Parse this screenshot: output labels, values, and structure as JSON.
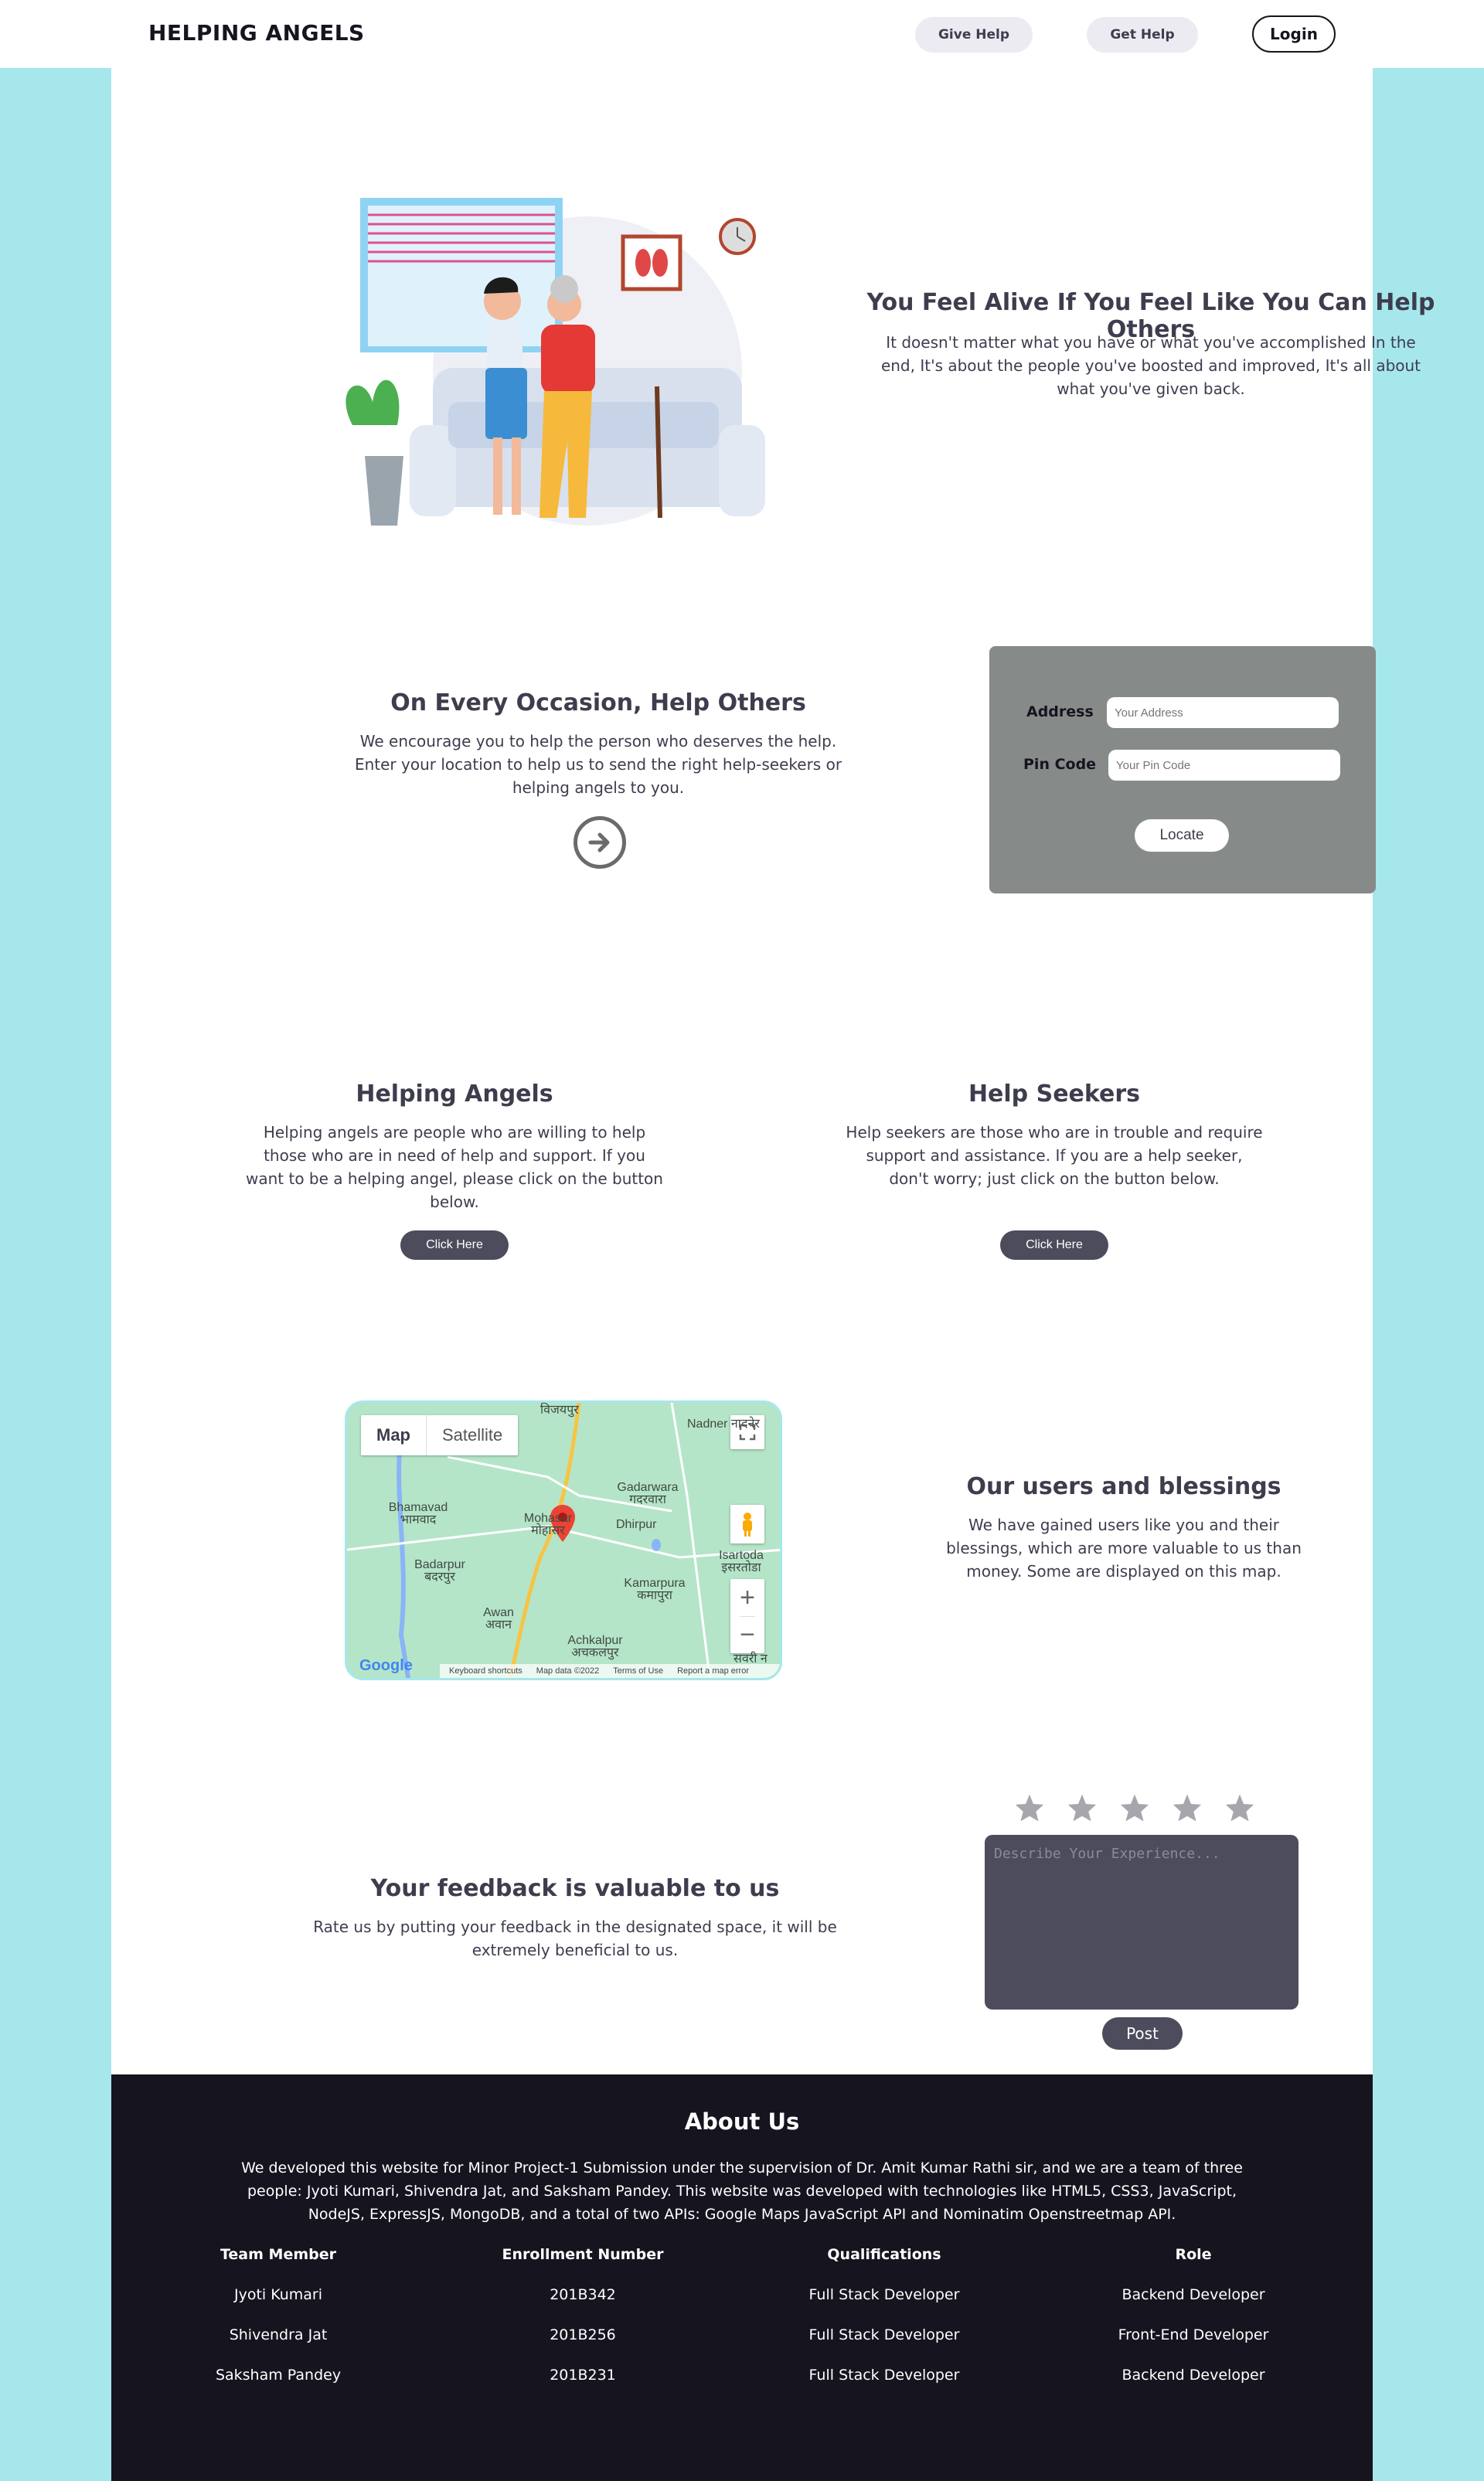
{
  "header": {
    "brand": "HELPING ANGELS",
    "give_help": "Give Help",
    "get_help": "Get Help",
    "login": "Login"
  },
  "hero": {
    "title": "You Feel Alive If You Feel Like You Can Help Others",
    "text": "It doesn't matter what you have or what you've accomplished In the end, It's about the people you've boosted and improved, It's all about what you've given back."
  },
  "occasion": {
    "title": "On Every Occasion, Help Others",
    "text": "We encourage you to help the person who deserves the help. Enter your location to help us to send the right help-seekers or helping angels to you.",
    "address_label": "Address",
    "address_placeholder": "Your Address",
    "pincode_label": "Pin Code",
    "pincode_placeholder": "Your Pin Code",
    "locate_button": "Locate"
  },
  "roles": [
    {
      "title": "Helping Angels",
      "text": "Helping angels are people who are willing to help those who are in need of help and support. If you want to be a helping angel, please click on the button below.",
      "button": "Click Here"
    },
    {
      "title": "Help Seekers",
      "text": "Help seekers are those who are in trouble and require support and assistance. If you are a help seeker, don't worry; just click on the button below.",
      "button": "Click Here"
    }
  ],
  "map": {
    "tab_map": "Map",
    "tab_satellite": "Satellite",
    "places": [
      "विजयपुर",
      "Nadner नादनेर",
      "Gadarwara गदरवारा",
      "Bhamavad भामवाद",
      "Mohasar मोहासर",
      "Dhirpur",
      "Isartoda इसरतोडा",
      "Badarpur बदरपुर",
      "Kamarpura कमापुरा",
      "Awan अवान",
      "Achkalpur अचकलपुर",
      "सवरी न"
    ],
    "footer_items": [
      "Keyboard shortcuts",
      "Map data ©2022",
      "Terms of Use",
      "Report a map error"
    ],
    "google_logo": "Google"
  },
  "users": {
    "title": "Our users and blessings",
    "text": "We have gained users like you and their blessings, which are more valuable to us than money. Some are displayed on this map."
  },
  "feedback": {
    "title": "Your feedback is valuable to us",
    "text": "Rate us by putting your feedback in the designated space, it will be extremely beneficial to us.",
    "stars_selected": 0,
    "stars_total": 5,
    "placeholder": "Describe Your Experience...",
    "post_button": "Post"
  },
  "footer": {
    "title": "About Us",
    "text": "We developed this website for Minor Project-1 Submission under the supervision of Dr. Amit Kumar Rathi sir, and we are a team of three people: Jyoti Kumari, Shivendra Jat, and Saksham Pandey. This website was developed with technologies like HTML5, CSS3, JavaScript, NodeJS, ExpressJS, MongoDB, and a total of two APIs: Google Maps JavaScript API and Nominatim Openstreetmap API.",
    "columns": [
      "Team Member",
      "Enrollment Number",
      "Qualifications",
      "Role"
    ],
    "rows": [
      [
        "Jyoti Kumari",
        "201B342",
        "Full Stack Developer",
        "Backend Developer"
      ],
      [
        "Shivendra Jat",
        "201B256",
        "Full Stack Developer",
        "Front-End Developer"
      ],
      [
        "Saksham Pandey",
        "201B231",
        "Full Stack Developer",
        "Backend Developer"
      ]
    ]
  },
  "colors": {
    "page_bg": "#a6e7ec",
    "dark": "#15141f",
    "button_dark": "#4d4c5c",
    "locate_panel": "#868b8a"
  }
}
